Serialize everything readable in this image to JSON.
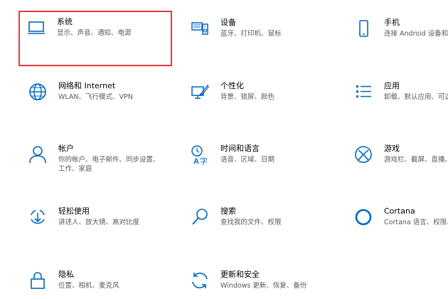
{
  "accent_color": "#0067c0",
  "selection_color": "#e33b3b",
  "tiles": [
    {
      "title": "系统",
      "desc": "显示、声音、通知、电源",
      "icon": "laptop-icon"
    },
    {
      "title": "设备",
      "desc": "蓝牙、打印机、鼠标",
      "icon": "devices-icon"
    },
    {
      "title": "手机",
      "desc": "连接 Android 设备和",
      "icon": "phone-icon"
    },
    {
      "title": "网络和 Internet",
      "desc": "WLAN、飞行模式、VPN",
      "icon": "globe-icon"
    },
    {
      "title": "个性化",
      "desc": "背景、锁屏、颜色",
      "icon": "personalization-icon"
    },
    {
      "title": "应用",
      "desc": "卸载、默认应用、可选",
      "icon": "apps-list-icon"
    },
    {
      "title": "帐户",
      "desc": "你的帐户、电子邮件、同步设置、工作、家庭",
      "icon": "person-icon"
    },
    {
      "title": "时间和语言",
      "desc": "语音、区域、日期",
      "icon": "time-language-icon"
    },
    {
      "title": "游戏",
      "desc": "游戏栏、截屏、直播、",
      "icon": "xbox-icon"
    },
    {
      "title": "轻松使用",
      "desc": "讲述人、放大镜、高对比度",
      "icon": "ease-of-access-icon"
    },
    {
      "title": "搜索",
      "desc": "查找我的文件、权限",
      "icon": "search-icon"
    },
    {
      "title": "Cortana",
      "desc": "Cortana 语言、权限、",
      "icon": "cortana-icon"
    },
    {
      "title": "隐私",
      "desc": "位置、相机、麦克风",
      "icon": "lock-icon"
    },
    {
      "title": "更新和安全",
      "desc": "Windows 更新、恢复、备份",
      "icon": "update-icon"
    }
  ]
}
